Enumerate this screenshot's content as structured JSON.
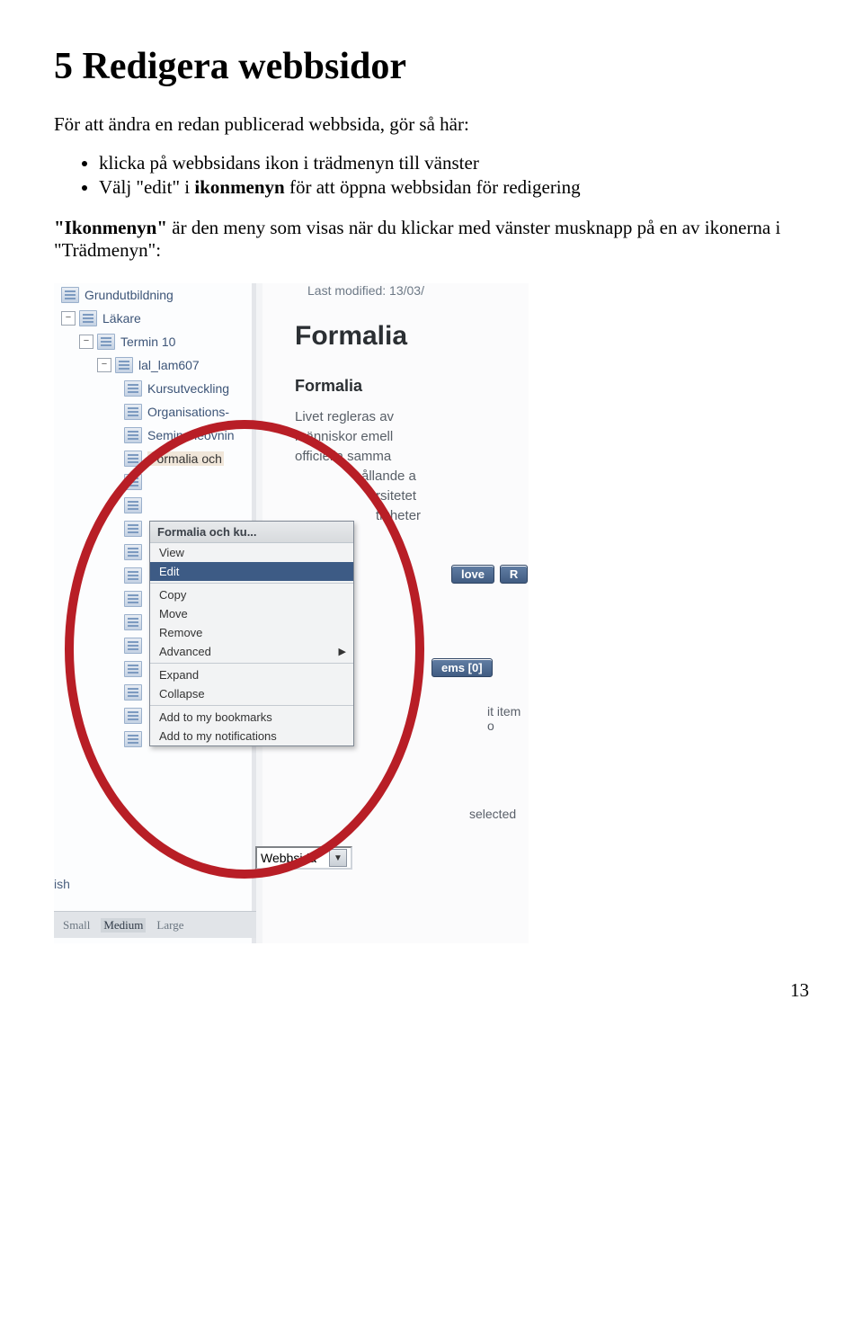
{
  "heading": "5 Redigera webbsidor",
  "intro": "För att ändra en redan publicerad webbsida, gör så här:",
  "bullets": [
    "klicka på webbsidans ikon i trädmenyn till vänster",
    "Välj \"edit\" i ikonmenyn för att öppna webbsidan för redigering"
  ],
  "after": "\"Ikonmenyn\" är den meny som visas när du klickar med vänster musknapp på en av ikonerna i \"Trädmenyn\":",
  "page_number": "13",
  "screenshot": {
    "tree": {
      "items": [
        {
          "indent": 8,
          "join": "",
          "label": "Grundutbildning"
        },
        {
          "indent": 8,
          "join": "−",
          "label": "Läkare"
        },
        {
          "indent": 28,
          "join": "−",
          "label": "Termin 10"
        },
        {
          "indent": 48,
          "join": "−",
          "label": "lal_lam607"
        },
        {
          "indent": 78,
          "join": "",
          "label": "Kursutveckling"
        },
        {
          "indent": 78,
          "join": "",
          "label": "Organisations-"
        },
        {
          "indent": 78,
          "join": "",
          "label": "Seminarieövnin"
        },
        {
          "indent": 78,
          "join": "",
          "label": "Formalia och",
          "selected": true
        },
        {
          "indent": 78,
          "join": "",
          "label": ""
        },
        {
          "indent": 78,
          "join": "",
          "label": ""
        },
        {
          "indent": 78,
          "join": "",
          "label": ""
        },
        {
          "indent": 78,
          "join": "",
          "label": ""
        },
        {
          "indent": 78,
          "join": "",
          "label": ""
        },
        {
          "indent": 78,
          "join": "",
          "label": ""
        },
        {
          "indent": 78,
          "join": "",
          "label": ""
        },
        {
          "indent": 78,
          "join": "",
          "label": ""
        },
        {
          "indent": 78,
          "join": "",
          "label": ""
        },
        {
          "indent": 78,
          "join": "",
          "label": ""
        },
        {
          "indent": 78,
          "join": "",
          "label": ""
        },
        {
          "indent": 78,
          "join": "",
          "label": ""
        }
      ]
    },
    "context_menu": {
      "header": "Formalia och ku...",
      "items": [
        {
          "label": "View"
        },
        {
          "label": "Edit",
          "highlight": true
        },
        {
          "sep": true
        },
        {
          "label": "Copy"
        },
        {
          "label": "Move"
        },
        {
          "label": "Remove"
        },
        {
          "label": "Advanced",
          "submenu": true
        },
        {
          "sep": true
        },
        {
          "label": "Expand"
        },
        {
          "label": "Collapse"
        },
        {
          "sep": true
        },
        {
          "label": "Add to my bookmarks"
        },
        {
          "label": "Add to my notifications"
        }
      ]
    },
    "right": {
      "last_modified": "Last modified: 13/03/",
      "title": "Formalia",
      "subtitle": "Formalia",
      "body_lines": [
        "Livet regleras av",
        "människor emell",
        "officiella samma",
        "ållande a",
        "rsitetet",
        "tigheter"
      ],
      "button1a": "love",
      "button1b": "R",
      "button2": "ems [0]",
      "item_text": "it item o",
      "selected_text": "selected",
      "dropdown": "Webbsida"
    },
    "trash_label": "ish",
    "zoom": {
      "small": "Small",
      "medium": "Medium",
      "large": "Large"
    }
  }
}
